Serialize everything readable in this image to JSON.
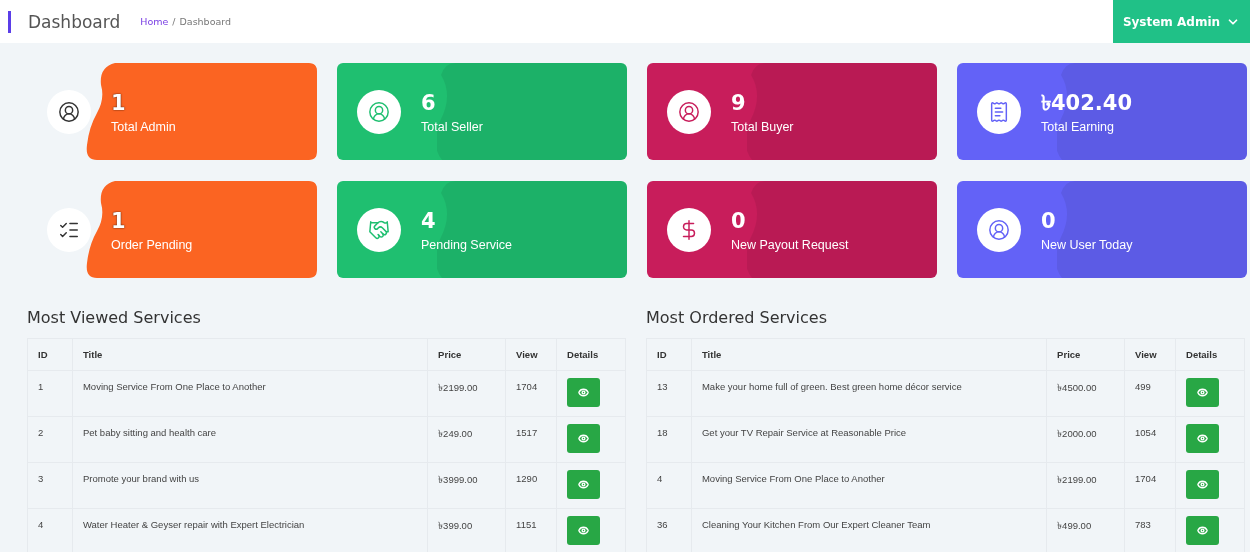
{
  "header": {
    "title": "Dashboard",
    "breadcrumb_separator": "/",
    "breadcrumb": [
      {
        "label": "Home",
        "kind": "link"
      },
      {
        "label": "Dashboard",
        "kind": "current"
      }
    ],
    "user_menu": "System Admin"
  },
  "stats": [
    {
      "value": "1",
      "label": "Total Admin",
      "color": "#fb6422",
      "kind": "cut"
    },
    {
      "value": "6",
      "label": "Total Seller",
      "color": "#1fbf70",
      "kind": "solid"
    },
    {
      "value": "9",
      "label": "Total Buyer",
      "color": "#c81d5b",
      "kind": "solid"
    },
    {
      "value": "৳402.40",
      "label": "Total Earning",
      "color": "#6362f7",
      "kind": "solid"
    },
    {
      "value": "1",
      "label": "Order Pending",
      "color": "#fb6422",
      "kind": "cut"
    },
    {
      "value": "4",
      "label": "Pending Service",
      "color": "#1fbf70",
      "kind": "solid"
    },
    {
      "value": "0",
      "label": "New Payout Request",
      "color": "#c81d5b",
      "kind": "solid"
    },
    {
      "value": "0",
      "label": "New User Today",
      "color": "#6362f7",
      "kind": "solid"
    }
  ],
  "tables": [
    {
      "title": "Most Viewed Services",
      "columns": [
        "ID",
        "Title",
        "Price",
        "View",
        "Details"
      ],
      "rows": [
        {
          "cells": [
            "1",
            "Moving Service From One Place to Another",
            "৳2199.00",
            "1704"
          ]
        },
        {
          "cells": [
            "2",
            "Pet baby sitting and health care",
            "৳249.00",
            "1517"
          ]
        },
        {
          "cells": [
            "3",
            "Promote your brand with us",
            "৳3999.00",
            "1290"
          ]
        },
        {
          "cells": [
            "4",
            "Water Heater & Geyser repair with Expert Electrician",
            "৳399.00",
            "1151"
          ]
        }
      ]
    },
    {
      "title": "Most Ordered Services",
      "columns": [
        "ID",
        "Title",
        "Price",
        "View",
        "Details"
      ],
      "rows": [
        {
          "cells": [
            "13",
            "Make your home full of green. Best green home décor service",
            "৳4500.00",
            "499"
          ]
        },
        {
          "cells": [
            "18",
            "Get your TV Repair Service at Reasonable Price",
            "৳2000.00",
            "1054"
          ]
        },
        {
          "cells": [
            "4",
            "Moving Service From One Place to Another",
            "৳2199.00",
            "1704"
          ]
        },
        {
          "cells": [
            "36",
            "Cleaning Your Kitchen From Our Expert Cleaner Team",
            "৳499.00",
            "783"
          ]
        }
      ]
    }
  ]
}
